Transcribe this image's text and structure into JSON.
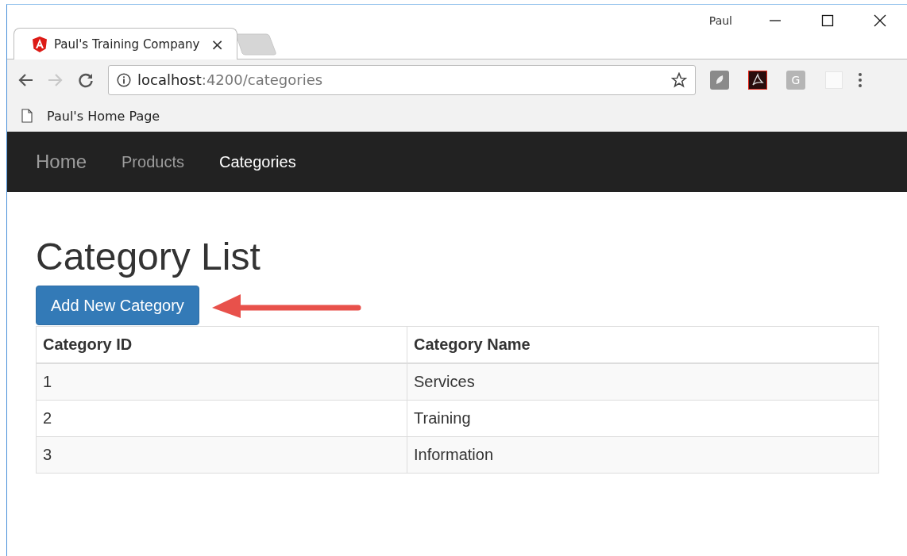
{
  "window": {
    "user": "Paul"
  },
  "tabs": [
    {
      "title": "Paul's Training Company",
      "close": "×",
      "selected": true
    }
  ],
  "address": {
    "host": "localhost",
    "path": ":4200/categories"
  },
  "extensions": [
    {
      "kind": "shield"
    },
    {
      "kind": "pdf"
    },
    {
      "kind": "letter",
      "label": "G"
    },
    {
      "kind": "blank"
    }
  ],
  "bookmarks": [
    {
      "label": "Paul's Home Page"
    }
  ],
  "navbar": {
    "brand": "Home",
    "links": [
      {
        "label": "Products",
        "selected": false
      },
      {
        "label": "Categories",
        "selected": true
      }
    ]
  },
  "page": {
    "title": "Category List",
    "add_button": "Add New Category"
  },
  "table": {
    "columns": [
      "Category ID",
      "Category Name"
    ],
    "rows": [
      [
        "1",
        "Services"
      ],
      [
        "2",
        "Training"
      ],
      [
        "3",
        "Information"
      ]
    ]
  }
}
